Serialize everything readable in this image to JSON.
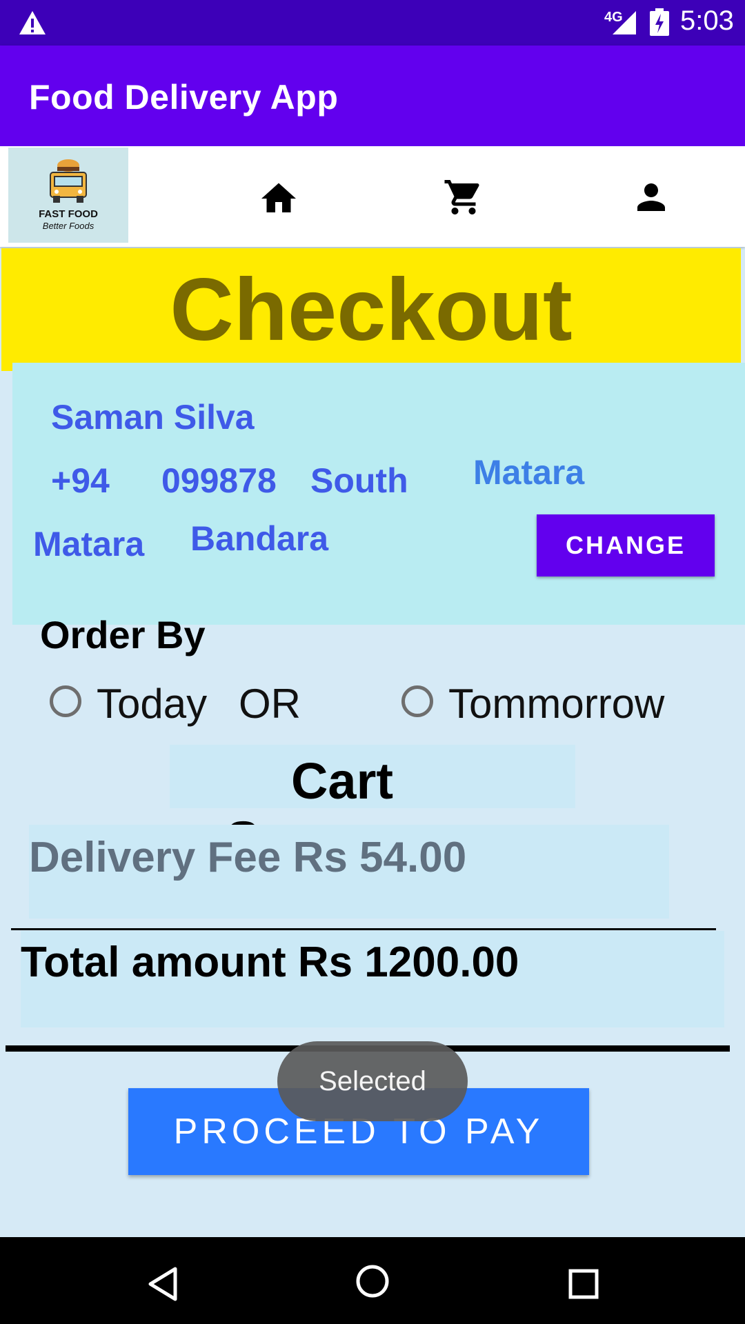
{
  "status_bar": {
    "network": "4G",
    "time": "5:03"
  },
  "app_bar": {
    "title": "Food Delivery App"
  },
  "nav": {
    "logo_line1": "FAST FOOD",
    "logo_line2": "Better Foods",
    "icons": [
      "home-icon",
      "cart-icon",
      "profile-icon"
    ]
  },
  "checkout": {
    "title": "Checkout"
  },
  "address": {
    "name": "Saman Silva",
    "phone_code": "+94",
    "phone_number": "099878",
    "street": "South",
    "city": "Matara",
    "district": "Matara",
    "lastname": "Bandara",
    "change_label": "CHANGE"
  },
  "order_by": {
    "label": "Order By",
    "today": "Today",
    "or": "OR",
    "tomorrow": "Tommorrow"
  },
  "cart_summary": {
    "title": "Cart Summary",
    "delivery_fee": "Delivery Fee Rs 54.00",
    "total": "Total amount Rs 1200.00"
  },
  "proceed": {
    "label": "PROCEED TO PAY"
  },
  "toast": {
    "text": "Selected"
  },
  "colors": {
    "status_bar": "#3d00b8",
    "app_bar": "#6200ee",
    "banner": "#ffeb00",
    "card": "#b9ecf2",
    "proceed": "#2979ff"
  }
}
